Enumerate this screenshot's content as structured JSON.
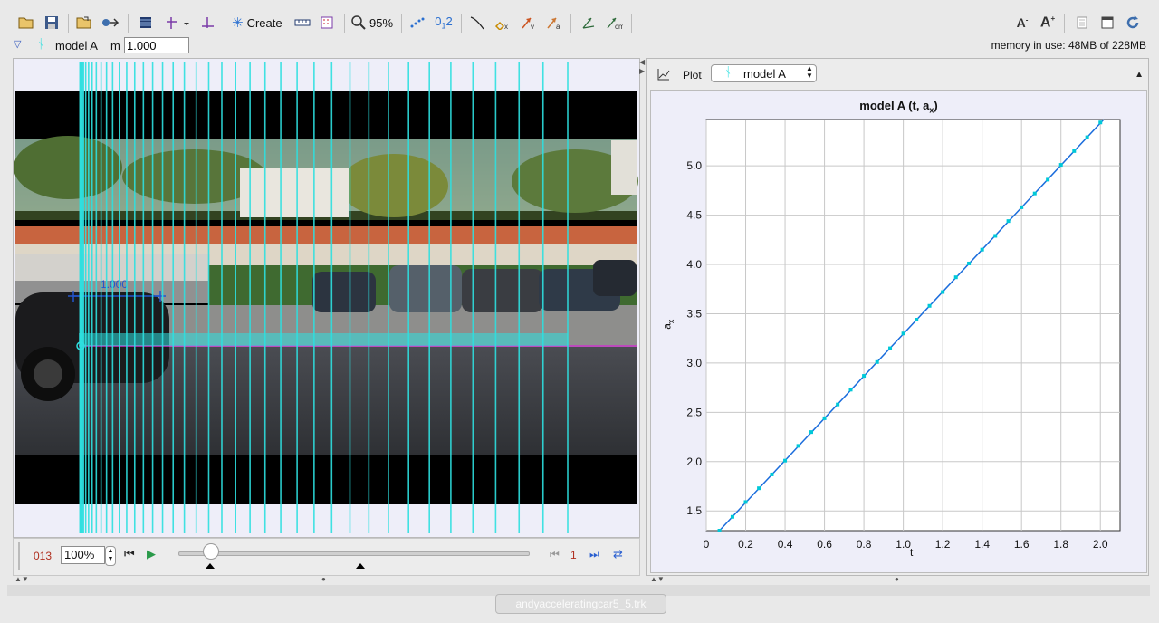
{
  "toolbar": {
    "create_label": "Create",
    "zoom_label": "95%",
    "icons": [
      "open-icon",
      "save-icon",
      "open-folder-icon",
      "export-icon",
      "clip-settings-icon",
      "coordinate-axes-icon",
      "calibration-icon",
      "track-create-icon",
      "tape-measure-icon",
      "filter-icon",
      "zoom-icon",
      "trail-icon",
      "label-icon",
      "path-icon",
      "mass-icon",
      "velocity-icon",
      "acceleration-icon",
      "vector-sum-icon",
      "center-of-mass-icon",
      "font-increase-icon",
      "font-larger-icon",
      "notes-icon",
      "window-icon",
      "refresh-icon"
    ]
  },
  "track": {
    "name": "model A",
    "mass_label": "m",
    "mass_value": "1.000",
    "memory_text": "memory in use: 48MB of 228MB"
  },
  "video": {
    "calibration_label": "1.000",
    "colors": {
      "track_lines": "#2ee0e0",
      "axis": "#cc33cc",
      "calib": "#2255cc"
    }
  },
  "player": {
    "frame_counter": "013",
    "zoom_value": "100%",
    "step_value": "1",
    "slider_position": 0.09,
    "start_marker": 0.09,
    "end_marker": 0.52
  },
  "plot_panel": {
    "plot_label": "Plot",
    "track_select": "model A",
    "title_main": "model A (t, a",
    "title_sub": "x",
    "title_end": ")",
    "xlabel": "t",
    "ylabel_main": "a",
    "ylabel_sub": "x"
  },
  "chart_data": {
    "type": "line",
    "title": "model A (t, ax)",
    "xlabel": "t",
    "ylabel": "ax",
    "xlim": [
      0,
      2.1
    ],
    "ylim": [
      1.3,
      5.47
    ],
    "xticks": [
      "0",
      "0.2",
      "0.4",
      "0.6",
      "0.8",
      "1.0",
      "1.2",
      "1.4",
      "1.6",
      "1.8",
      "2.0"
    ],
    "yticks": [
      "1.5",
      "2.0",
      "2.5",
      "3.0",
      "3.5",
      "4.0",
      "4.5",
      "5.0"
    ],
    "x_start": 0.067,
    "x_end": 2.017,
    "y_start": 1.3,
    "y_end": 5.47,
    "grid": true,
    "series": [
      {
        "name": "model A",
        "color": "#00c8d8",
        "x": [
          0.067,
          0.133,
          0.2,
          0.267,
          0.333,
          0.4,
          0.467,
          0.533,
          0.6,
          0.667,
          0.733,
          0.8,
          0.867,
          0.933,
          1.0,
          1.067,
          1.133,
          1.2,
          1.267,
          1.333,
          1.4,
          1.467,
          1.533,
          1.6,
          1.667,
          1.733,
          1.8,
          1.867,
          1.933,
          2.0
        ],
        "y": [
          1.3,
          1.44,
          1.59,
          1.73,
          1.87,
          2.01,
          2.16,
          2.3,
          2.44,
          2.58,
          2.73,
          2.87,
          3.01,
          3.15,
          3.3,
          3.44,
          3.58,
          3.72,
          3.87,
          4.01,
          4.15,
          4.29,
          4.44,
          4.58,
          4.72,
          4.86,
          5.01,
          5.15,
          5.29,
          5.44
        ]
      }
    ]
  },
  "status": {
    "filename": "andyacceleratingcar5_5.trk"
  }
}
